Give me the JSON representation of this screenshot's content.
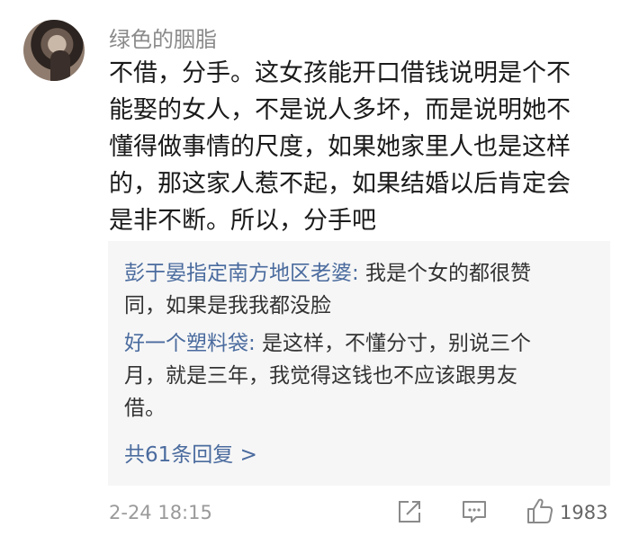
{
  "comment": {
    "username": "绿色的胭脂",
    "content_lines": [
      "不借，分手。这女孩能开口借钱说明是个不",
      "能娶的女人，不是说人多坏，而是说明她不",
      "懂得做事情的尺度，如果她家里人也是这样",
      "的，那这家人惹不起，如果结婚以后肯定会",
      "是非不断。所以，分手吧"
    ],
    "timestamp": "2-24 18:15",
    "like_count": "1983"
  },
  "replies": [
    {
      "author": "彭于晏指定南方地区老婆",
      "separator": ":",
      "text_lines": [
        " 我是个女的都很赞",
        "同，如果是我我都没脸"
      ]
    },
    {
      "author": "好一个塑料袋",
      "separator": ":",
      "text_lines": [
        " 是这样，不懂分寸，别说三个",
        "月，就是三年，我觉得这钱也不应该跟男友",
        "借。"
      ]
    }
  ],
  "more_replies": "共61条回复 >",
  "icons": {
    "avatar": "user-avatar",
    "share": "share-icon",
    "comment": "comment-icon",
    "like": "thumbs-up-icon"
  },
  "colors": {
    "link": "#4a6b9e",
    "username": "#8a8a8a",
    "reply_bg": "#f6f6f6"
  }
}
